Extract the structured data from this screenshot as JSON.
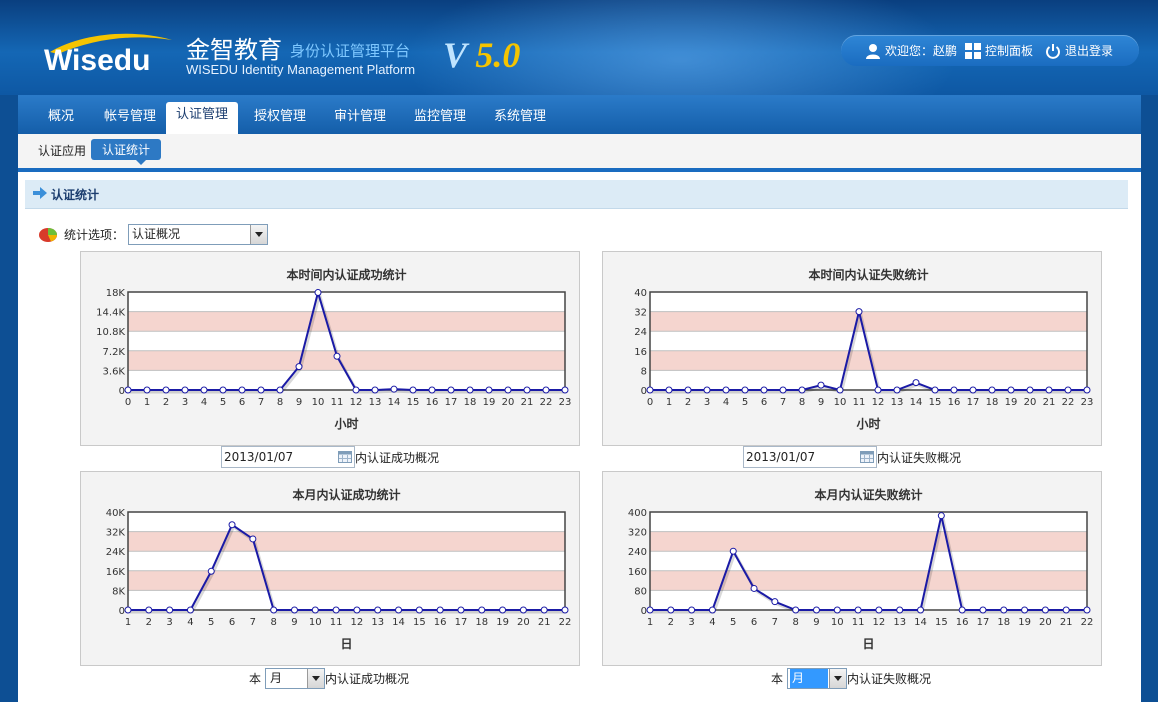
{
  "header": {
    "logo_text": "Wisedu",
    "brand_cn": "金智教育",
    "brand_sub": "身份认证管理平台",
    "brand_en": "WISEDU Identity Management Platform",
    "version_v": "V",
    "version_num": "5.0",
    "welcome": "欢迎您：赵鹏",
    "control_panel": "控制面板",
    "logout": "退出登录"
  },
  "nav": {
    "items": [
      "概况",
      "帐号管理",
      "认证管理",
      "授权管理",
      "审计管理",
      "监控管理",
      "系统管理"
    ],
    "active": "认证管理"
  },
  "subnav": {
    "items": [
      "认证应用",
      "认证统计"
    ],
    "active": "认证统计"
  },
  "panel": {
    "title": "认证统计",
    "option_label": "统计选项：",
    "option_value": "认证概况"
  },
  "controls": {
    "date1": "2013/01/07",
    "date1_suffix": "内认证成功概况",
    "date2": "2013/01/07",
    "date2_suffix": "内认证失败概况",
    "prefix3": "本",
    "select3": "月",
    "suffix3": "内认证成功概况",
    "prefix4": "本",
    "select4": "月",
    "suffix4": "内认证失败概况"
  },
  "colors": {
    "line": "#1a1aa6",
    "band": "#f5d5cf",
    "header_bg": "#0e58a4",
    "accent": "#2d79c4"
  },
  "chart_data": [
    {
      "type": "line",
      "title": "本时间内认证成功统计",
      "xlabel": "小时",
      "ylabel": "",
      "x": [
        0,
        1,
        2,
        3,
        4,
        5,
        6,
        7,
        8,
        9,
        10,
        11,
        12,
        13,
        14,
        15,
        16,
        17,
        18,
        19,
        20,
        21,
        22,
        23
      ],
      "values": [
        0,
        0,
        0,
        0,
        0,
        0,
        0,
        0,
        0,
        4300,
        17900,
        6200,
        0,
        0,
        150,
        0,
        0,
        0,
        0,
        0,
        0,
        0,
        0,
        0
      ],
      "ylim": [
        0,
        18000
      ],
      "yticks": [
        "0",
        "3.6K",
        "7.2K",
        "10.8K",
        "14.4K",
        "18K"
      ]
    },
    {
      "type": "line",
      "title": "本时间内认证失败统计",
      "xlabel": "小时",
      "ylabel": "",
      "x": [
        0,
        1,
        2,
        3,
        4,
        5,
        6,
        7,
        8,
        9,
        10,
        11,
        12,
        13,
        14,
        15,
        16,
        17,
        18,
        19,
        20,
        21,
        22,
        23
      ],
      "values": [
        0,
        0,
        0,
        0,
        0,
        0,
        0,
        0,
        0,
        2,
        0,
        32,
        0,
        0,
        3,
        0,
        0,
        0,
        0,
        0,
        0,
        0,
        0,
        0
      ],
      "ylim": [
        0,
        40
      ],
      "yticks": [
        "0",
        "8",
        "16",
        "24",
        "32",
        "40"
      ]
    },
    {
      "type": "line",
      "title": "本月内认证成功统计",
      "xlabel": "日",
      "ylabel": "",
      "x": [
        1,
        2,
        3,
        4,
        5,
        6,
        7,
        8,
        9,
        10,
        11,
        12,
        13,
        14,
        15,
        16,
        17,
        18,
        19,
        20,
        21,
        22
      ],
      "values": [
        0,
        0,
        0,
        0,
        15800,
        34800,
        29000,
        0,
        0,
        0,
        0,
        0,
        0,
        0,
        0,
        0,
        0,
        0,
        0,
        0,
        0,
        0
      ],
      "ylim": [
        0,
        40000
      ],
      "yticks": [
        "0",
        "8K",
        "16K",
        "24K",
        "32K",
        "40K"
      ]
    },
    {
      "type": "line",
      "title": "本月内认证失败统计",
      "xlabel": "日",
      "ylabel": "",
      "x": [
        1,
        2,
        3,
        4,
        5,
        6,
        7,
        8,
        9,
        10,
        11,
        12,
        13,
        14,
        15,
        16,
        17,
        18,
        19,
        20,
        21,
        22
      ],
      "values": [
        0,
        0,
        0,
        0,
        240,
        88,
        34,
        0,
        0,
        0,
        0,
        0,
        0,
        0,
        385,
        0,
        0,
        0,
        0,
        0,
        0,
        0
      ],
      "ylim": [
        0,
        400
      ],
      "yticks": [
        "0",
        "80",
        "160",
        "240",
        "320",
        "400"
      ]
    }
  ]
}
